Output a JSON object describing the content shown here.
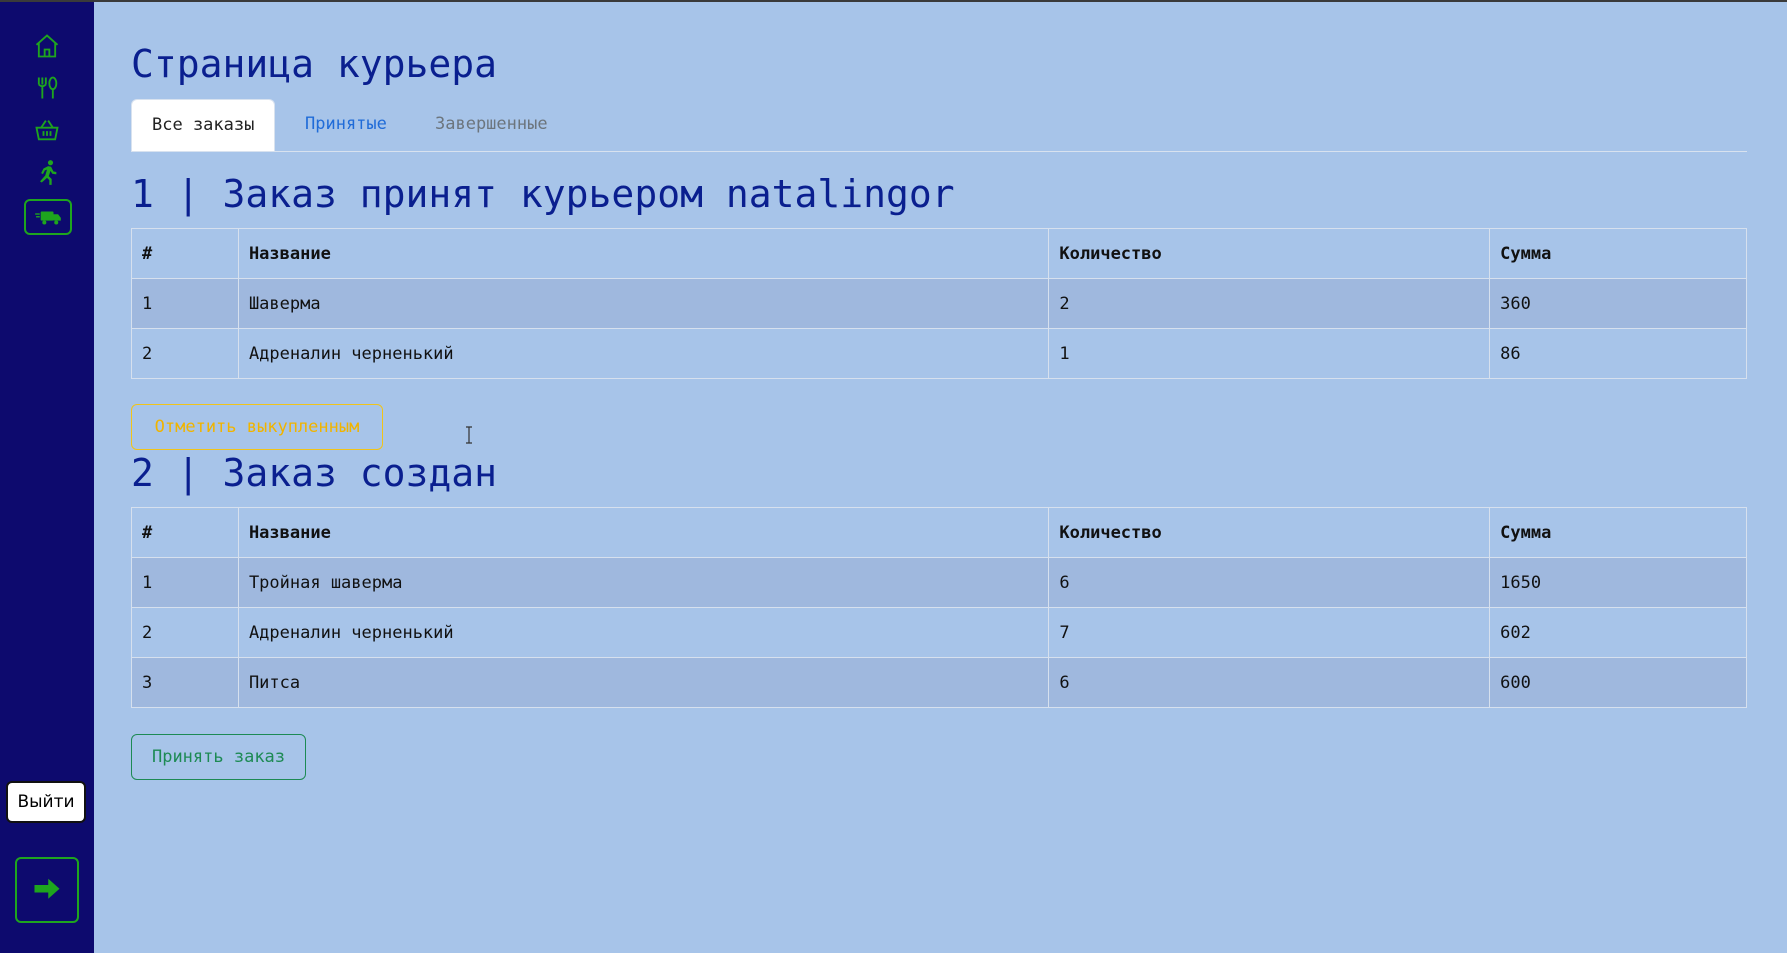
{
  "sidebar": {
    "icons": [
      "home-icon",
      "utensils-icon",
      "basket-icon",
      "running-person-icon",
      "delivery-truck-icon"
    ],
    "logout_tooltip": "Выйти",
    "accent": "#1ea51e",
    "background": "#0d0a6e"
  },
  "page": {
    "title": "Страница курьера",
    "background": "#a7c4e9"
  },
  "tabs": [
    {
      "label": "Все заказы",
      "active": true
    },
    {
      "label": "Принятые",
      "active": false
    },
    {
      "label": "Завершенные",
      "active": false
    }
  ],
  "table_headers": {
    "num": "#",
    "name": "Название",
    "qty": "Количество",
    "sum": "Сумма"
  },
  "orders": [
    {
      "title": "1 | Заказ принят курьером natalingor",
      "rows": [
        {
          "num": "1",
          "name": "Шаверма",
          "qty": "2",
          "sum": "360"
        },
        {
          "num": "2",
          "name": "Адреналин черненький",
          "qty": "1",
          "sum": "86"
        }
      ],
      "button": "Отметить выкупленным"
    },
    {
      "title": "2 | Заказ создан",
      "rows": [
        {
          "num": "1",
          "name": "Тройная шаверма",
          "qty": "6",
          "sum": "1650"
        },
        {
          "num": "2",
          "name": "Адреналин черненький",
          "qty": "7",
          "sum": "602"
        },
        {
          "num": "3",
          "name": "Питса",
          "qty": "6",
          "sum": "600"
        }
      ],
      "button": "Принять заказ"
    }
  ]
}
